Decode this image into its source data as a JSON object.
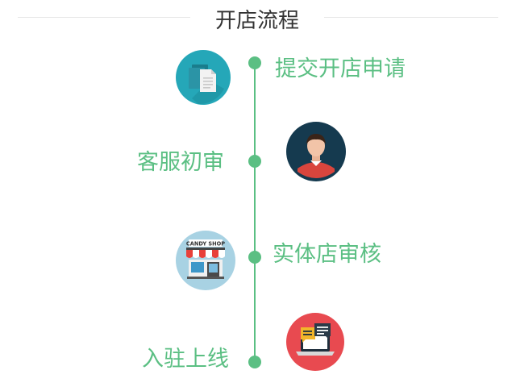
{
  "header": {
    "title": "开店流程"
  },
  "colors": {
    "accent": "#5bbf83",
    "title_text": "#333333",
    "divider": "#e6e6e6"
  },
  "steps": [
    {
      "label": "提交开店申请",
      "icon": "document-copy-icon"
    },
    {
      "label": "客服初审",
      "icon": "customer-service-person-icon"
    },
    {
      "label": "实体店审核",
      "icon": "candy-shop-storefront-icon"
    },
    {
      "label": "入驻上线",
      "icon": "laptop-chat-icon"
    }
  ],
  "shop_sign_text": "CANDY SHOP"
}
